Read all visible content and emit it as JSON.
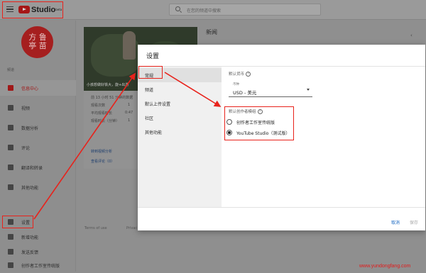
{
  "header": {
    "logo_text": "Studio",
    "logo_tm": "beta",
    "search_placeholder": "在您的频道中搜索"
  },
  "sidebar": {
    "channel_label": "频道",
    "avatar_text": "方 鲁 亭 苗",
    "items": [
      {
        "label": "信息中心",
        "icon": "dashboard-icon",
        "active": true
      },
      {
        "label": "视频",
        "icon": "video-icon"
      },
      {
        "label": "数据分析",
        "icon": "analytics-icon"
      },
      {
        "label": "评论",
        "icon": "comments-icon"
      },
      {
        "label": "翻译和转录",
        "icon": "translate-icon"
      },
      {
        "label": "其他功能",
        "icon": "other-features-icon"
      },
      {
        "label": "设置",
        "icon": "gear-icon"
      },
      {
        "label": "新增功能",
        "icon": "new-features-icon"
      },
      {
        "label": "发送反馈",
        "icon": "feedback-icon"
      },
      {
        "label": "创作者工作室传统版",
        "icon": "classic-studio-icon"
      }
    ]
  },
  "background": {
    "video_caption": "小孩想做好铁大，旋+出游",
    "rows": [
      "前 13 小时 51 分钟的数据",
      "观看次数",
      "平均观看时长",
      "观看时长（分钟）"
    ],
    "row_values": [
      "1",
      "0:47",
      "1"
    ],
    "link1": "转到视频分析",
    "link2": "查看评论（0）",
    "news_title": "新闻",
    "terms": "Terms of use",
    "privacy": "Privac"
  },
  "modal": {
    "title": "设置",
    "nav": [
      "常规",
      "频道",
      "默认上传设置",
      "社区",
      "其他功能"
    ],
    "currency_label": "默认货币",
    "currency_caption": "币种",
    "currency_value": "USD - 美元",
    "studio_label": "默认创作者模组",
    "options": [
      {
        "label": "创作者工作室传统版",
        "selected": false
      },
      {
        "label": "YouTube Studio（测试版）",
        "selected": true
      }
    ],
    "cancel": "取消",
    "save": "保存"
  },
  "watermark": "www.yundongfang.com",
  "colors": {
    "highlight": "#e8221b",
    "accent": "#a01818",
    "link": "#1565c0"
  }
}
